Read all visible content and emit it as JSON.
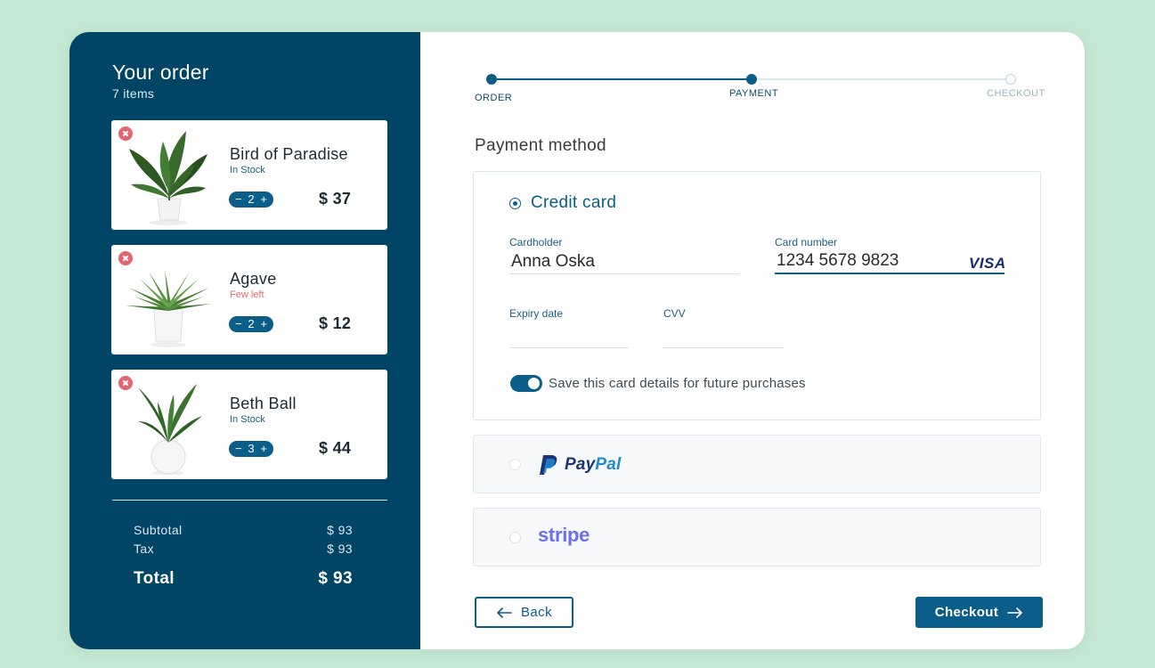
{
  "order": {
    "title": "Your order",
    "count": "7 items",
    "items": [
      {
        "name": "Bird of Paradise",
        "stock": "In Stock",
        "qty": "2",
        "price": "$ 37",
        "minus": "−",
        "plus": "+"
      },
      {
        "name": "Agave",
        "stock": "Few left",
        "qty": "2",
        "price": "$ 12",
        "minus": "−",
        "plus": "+"
      },
      {
        "name": "Beth Ball",
        "stock": "In Stock",
        "qty": "3",
        "price": "$ 44",
        "minus": "−",
        "plus": "+"
      }
    ],
    "subtotal_label": "Subtotal",
    "subtotal_value": "$ 93",
    "tax_label": "Tax",
    "tax_value": "$ 93",
    "total_label": "Total",
    "total_value": "$ 93"
  },
  "stepper": {
    "steps": [
      {
        "label": "ORDER",
        "state": "done"
      },
      {
        "label": "PAYMENT",
        "state": "current"
      },
      {
        "label": "CHECKOUT",
        "state": "todo"
      }
    ]
  },
  "payment": {
    "title": "Payment method",
    "credit_card_label": "Credit card",
    "cardholder_label": "Cardholder",
    "cardholder_value": "Anna Oska",
    "card_number_label": "Card number",
    "card_number_value": "1234 5678 9823",
    "card_brand": "VISA",
    "expiry_label": "Expiry date",
    "expiry_value": "",
    "cvv_label": "CVV",
    "cvv_value": "",
    "save_card_label": "Save this card details for future purchases",
    "save_card_enabled": true,
    "paypal_pay": "Pay",
    "paypal_pal": "Pal",
    "stripe_label": "stripe"
  },
  "actions": {
    "back_label": "Back",
    "checkout_label": "Checkout"
  },
  "colors": {
    "background": "#c4e8d2",
    "sidebar": "#004466",
    "accent": "#0b5e8a",
    "warning": "#e56a6a",
    "stripe": "#6b6ff0"
  },
  "icons": {
    "remove": "close-circle-icon",
    "back": "arrow-left-icon",
    "checkout": "arrow-right-icon",
    "paypal": "paypal-icon"
  }
}
